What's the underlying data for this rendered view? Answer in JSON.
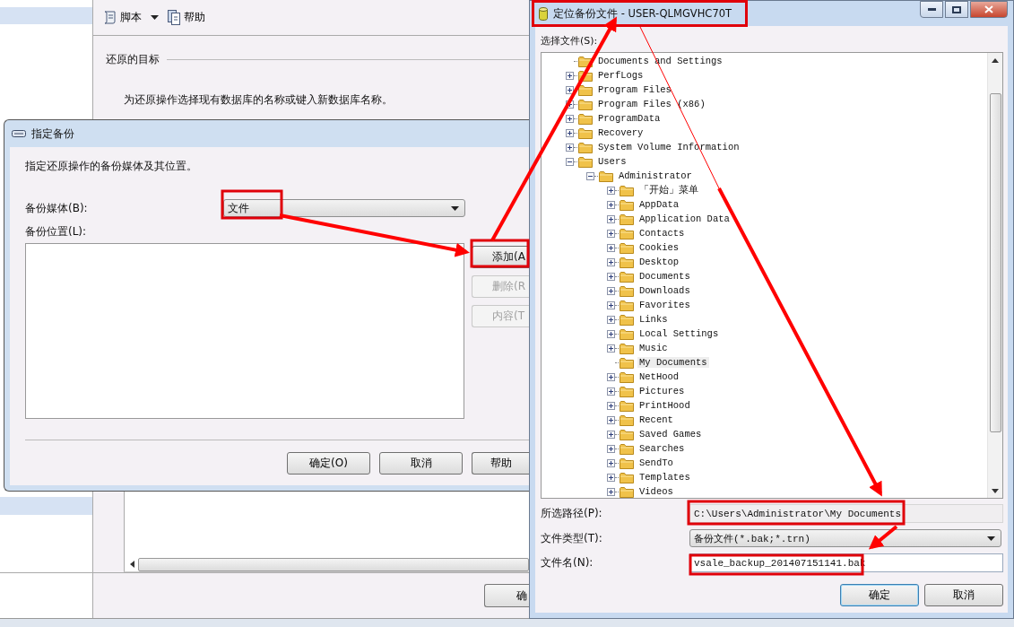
{
  "main_window": {
    "toolbar": {
      "script_button": "脚本",
      "help_button": "帮助"
    },
    "section_title": "还原的目标",
    "instruction": "为还原操作选择现有数据库的名称或键入新数据库名称。",
    "ok_button": "确"
  },
  "backup_dialog": {
    "title": "指定备份",
    "description": "指定还原操作的备份媒体及其位置。",
    "media_label": "备份媒体(B):",
    "media_value": "文件",
    "location_label": "备份位置(L):",
    "side_buttons": [
      {
        "label": "添加(A",
        "disabled": false
      },
      {
        "label": "删除(R",
        "disabled": true
      },
      {
        "label": "内容(T",
        "disabled": true
      }
    ],
    "buttons": [
      "确定(O)",
      "取消",
      "帮助"
    ]
  },
  "file_dialog": {
    "title": "定位备份文件 - USER-QLMGVHC70T",
    "tree_label": "选择文件(S):",
    "tree": [
      {
        "label": "Documents and Settings",
        "kind": "leaf",
        "selected": false
      },
      {
        "label": "PerfLogs",
        "kind": "collapsed",
        "selected": false
      },
      {
        "label": "Program Files",
        "kind": "collapsed",
        "selected": false
      },
      {
        "label": "Program Files (x86)",
        "kind": "collapsed",
        "selected": false
      },
      {
        "label": "ProgramData",
        "kind": "collapsed",
        "selected": false
      },
      {
        "label": "Recovery",
        "kind": "collapsed",
        "selected": false
      },
      {
        "label": "System Volume Information",
        "kind": "collapsed",
        "selected": false
      },
      {
        "label": "Users",
        "kind": "expanded",
        "selected": false,
        "children": [
          {
            "label": "Administrator",
            "kind": "expanded",
            "selected": false,
            "children": [
              {
                "label": "「开始」菜单",
                "kind": "collapsed",
                "selected": false
              },
              {
                "label": "AppData",
                "kind": "collapsed",
                "selected": false
              },
              {
                "label": "Application Data",
                "kind": "collapsed",
                "selected": false
              },
              {
                "label": "Contacts",
                "kind": "collapsed",
                "selected": false
              },
              {
                "label": "Cookies",
                "kind": "collapsed",
                "selected": false
              },
              {
                "label": "Desktop",
                "kind": "collapsed",
                "selected": false
              },
              {
                "label": "Documents",
                "kind": "collapsed",
                "selected": false
              },
              {
                "label": "Downloads",
                "kind": "collapsed",
                "selected": false
              },
              {
                "label": "Favorites",
                "kind": "collapsed",
                "selected": false
              },
              {
                "label": "Links",
                "kind": "collapsed",
                "selected": false
              },
              {
                "label": "Local Settings",
                "kind": "collapsed",
                "selected": false
              },
              {
                "label": "Music",
                "kind": "collapsed",
                "selected": false
              },
              {
                "label": "My Documents",
                "kind": "leaf",
                "selected": true
              },
              {
                "label": "NetHood",
                "kind": "collapsed",
                "selected": false
              },
              {
                "label": "Pictures",
                "kind": "collapsed",
                "selected": false
              },
              {
                "label": "PrintHood",
                "kind": "collapsed",
                "selected": false
              },
              {
                "label": "Recent",
                "kind": "collapsed",
                "selected": false
              },
              {
                "label": "Saved Games",
                "kind": "collapsed",
                "selected": false
              },
              {
                "label": "Searches",
                "kind": "collapsed",
                "selected": false
              },
              {
                "label": "SendTo",
                "kind": "collapsed",
                "selected": false
              },
              {
                "label": "Templates",
                "kind": "collapsed",
                "selected": false
              },
              {
                "label": "Videos",
                "kind": "collapsed",
                "selected": false
              }
            ]
          }
        ]
      }
    ],
    "path_label": "所选路径(P):",
    "path_value": "C:\\Users\\Administrator\\My Documents",
    "type_label": "文件类型(T):",
    "type_value": "备份文件(*.bak;*.trn)",
    "name_label": "文件名(N):",
    "name_value": "vsale_backup_201407151141.bak",
    "buttons": [
      {
        "label": "确定",
        "default": true
      },
      {
        "label": "取消",
        "default": false
      }
    ]
  }
}
